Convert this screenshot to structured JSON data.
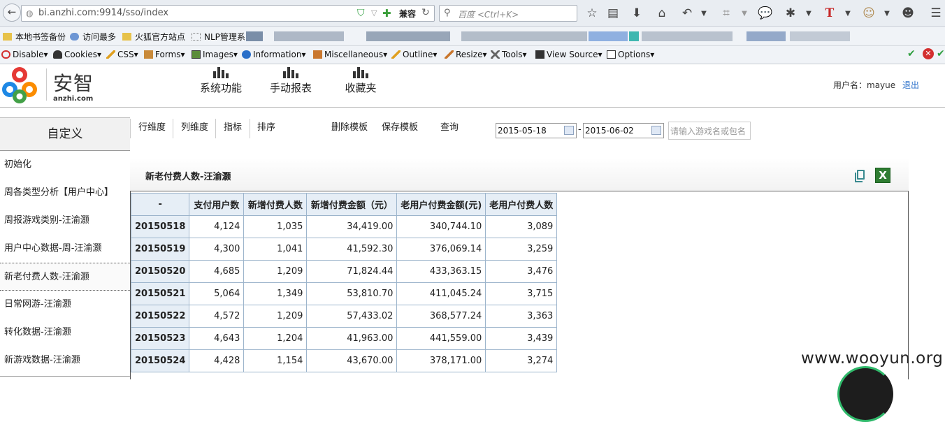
{
  "browser": {
    "url": "bi.anzhi.com:9914/sso/index",
    "compat_label": "兼容",
    "search_placeholder": "百度 <Ctrl+K>"
  },
  "bookmarks": [
    "本地书签备份",
    "访问最多",
    "火狐官方站点",
    "NLP管理系"
  ],
  "devbar": [
    "Disable▾",
    "Cookies▾",
    "CSS▾",
    "Forms▾",
    "Images▾",
    "Information▾",
    "Miscellaneous▾",
    "Outline▾",
    "Resize▾",
    "Tools▾",
    "View Source▾",
    "Options▾"
  ],
  "app": {
    "brand_name": "安智",
    "brand_domain": "anzhi.com",
    "nav": [
      "系统功能",
      "手动报表",
      "收藏夹"
    ],
    "user_label": "用户名：mayue",
    "logout": "退出"
  },
  "sidebar": {
    "title": "自定义",
    "items": [
      "初始化",
      "周各类型分析【用户中心】",
      "周报游戏类别-汪渝灏",
      "用户中心数据-周-汪渝灏",
      "新老付费人数-汪渝灏",
      "日常网游-汪渝灏",
      "转化数据-汪渝灏",
      "新游戏数据-汪渝灏"
    ],
    "active_index": 4
  },
  "toolbar": {
    "row_dim": "行维度",
    "col_dim": "列维度",
    "metric": "指标",
    "sort": "排序",
    "delete_tpl": "删除模板",
    "save_tpl": "保存模板",
    "query": "查询",
    "date_from": "2015-05-18",
    "date_sep": "-",
    "date_to": "2015-06-02",
    "game_search_placeholder": "请输入游戏名或包名"
  },
  "report": {
    "title": "新老付费人数-汪渝灏",
    "excel_label": "X",
    "columns": [
      "-",
      "支付用户数",
      "新增付费人数",
      "新增付费金额（元）",
      "老用户付费金额(元)",
      "老用户付费人数"
    ],
    "rows": [
      [
        "20150518",
        "4,124",
        "1,035",
        "34,419.00",
        "340,744.10",
        "3,089"
      ],
      [
        "20150519",
        "4,300",
        "1,041",
        "41,592.30",
        "376,069.14",
        "3,259"
      ],
      [
        "20150520",
        "4,685",
        "1,209",
        "71,824.44",
        "433,363.15",
        "3,476"
      ],
      [
        "20150521",
        "5,064",
        "1,349",
        "53,810.70",
        "411,045.24",
        "3,715"
      ],
      [
        "20150522",
        "4,572",
        "1,209",
        "57,433.02",
        "368,577.24",
        "3,363"
      ],
      [
        "20150523",
        "4,643",
        "1,204",
        "41,963.00",
        "441,559.00",
        "3,439"
      ],
      [
        "20150524",
        "4,428",
        "1,154",
        "43,670.00",
        "378,171.00",
        "3,274"
      ]
    ]
  },
  "watermark": "www.wooyun.org"
}
